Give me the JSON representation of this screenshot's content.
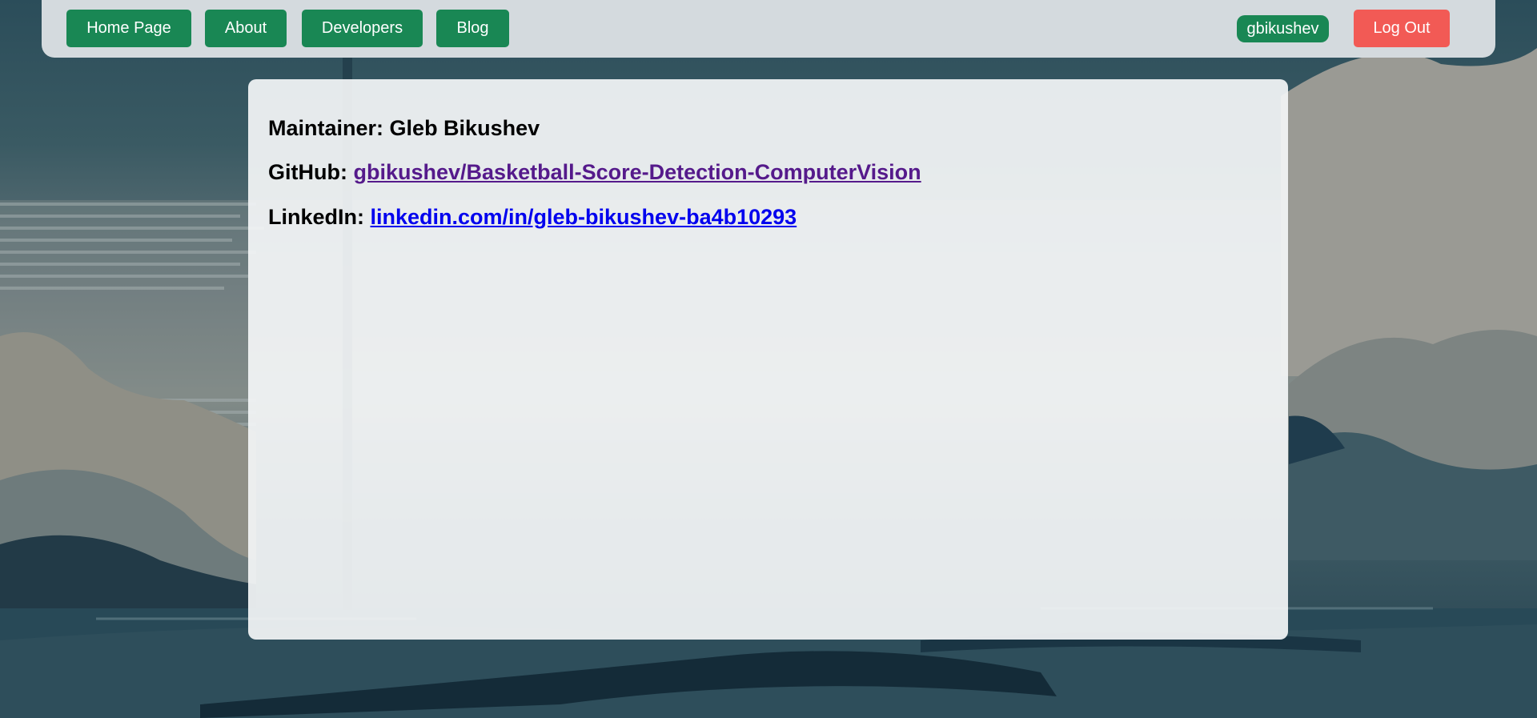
{
  "nav": {
    "home_label": "Home Page",
    "about_label": "About",
    "developers_label": "Developers",
    "blog_label": "Blog",
    "username": "gbikushev",
    "logout_label": "Log Out"
  },
  "content": {
    "maintainer_label": "Maintainer:",
    "maintainer_name": "Gleb Bikushev",
    "github_label": "GitHub:",
    "github_link_text": "gbikushev/Basketball-Score-Detection-ComputerVision",
    "linkedin_label": "LinkedIn:",
    "linkedin_link_text": "linkedin.com/in/gleb-bikushev-ba4b10293"
  },
  "colors": {
    "nav_button": "#198754",
    "logout_button": "#f25a55",
    "navbar_bg": "#d4dade",
    "visited_link": "#551a8b",
    "unvisited_link": "#0000ee"
  }
}
